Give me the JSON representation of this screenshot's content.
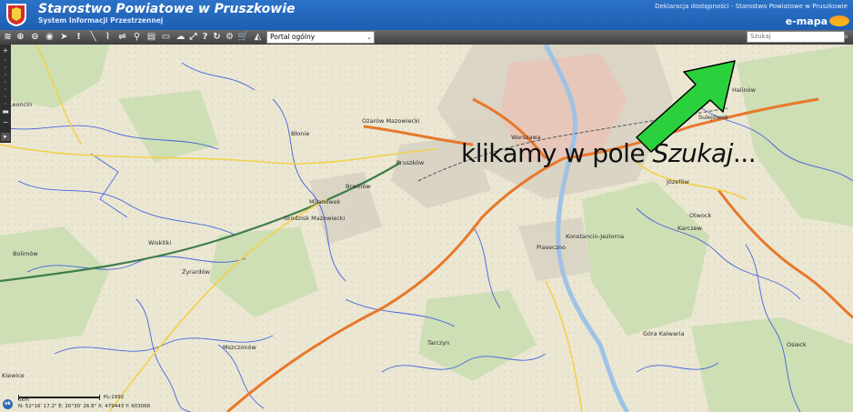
{
  "header": {
    "title": "Starostwo Powiatowe w Pruszkowie",
    "subtitle": "System Informacji Przestrzennej",
    "top_links": "Deklaracja dostępności - Starostwo Powiatowe w Pruszkowie",
    "brand": "e-mapa"
  },
  "toolbar": {
    "portal_select": "Portal ogólny",
    "search_placeholder": "Szukaj",
    "icons": [
      "layers-icon",
      "zoom-in-icon",
      "zoom-out-icon",
      "full-extent-icon",
      "zoom-window-icon",
      "pan-icon",
      "info-icon",
      "select-icon",
      "measure-length-icon",
      "measure-area-icon",
      "print-icon",
      "route-icon",
      "pin-icon",
      "export-icon",
      "attribute-icon",
      "grid-icon",
      "link-icon",
      "help-icon",
      "refresh-icon",
      "tools-icon",
      "cart-icon",
      "style-icon"
    ]
  },
  "map": {
    "places": [
      "Warszawa",
      "Ożarów Mazowiecki",
      "Pruszków",
      "Brwinów",
      "Grodzisk Mazowiecki",
      "Milanówek",
      "Piaseczno",
      "Konstancin-Jeziorna",
      "Józefów",
      "Otwock",
      "Karczew",
      "Góra Kalwaria",
      "Mszczonów",
      "Tarczyn",
      "Żyrardów",
      "Błonie",
      "Bolimów",
      "Wiskitki",
      "Leoncin",
      "Halinów",
      "Sulejówek",
      "Osieck",
      "Kiewice"
    ],
    "annotation_normal": "klikamy w pole ",
    "annotation_italic": "Szukaj",
    "annotation_end": "..."
  },
  "status": {
    "scale": "5km",
    "crs": "PL-1992",
    "coords": "N: 52°16' 17.2\"  E: 20°30' 26.8\"  X: 479443  Y: 603066",
    "ok": "ok"
  },
  "colors": {
    "header": "#2c72c7",
    "arrow": "#2bd13c",
    "roads_main": "#e8782b",
    "streams": "#2a4fe0"
  }
}
